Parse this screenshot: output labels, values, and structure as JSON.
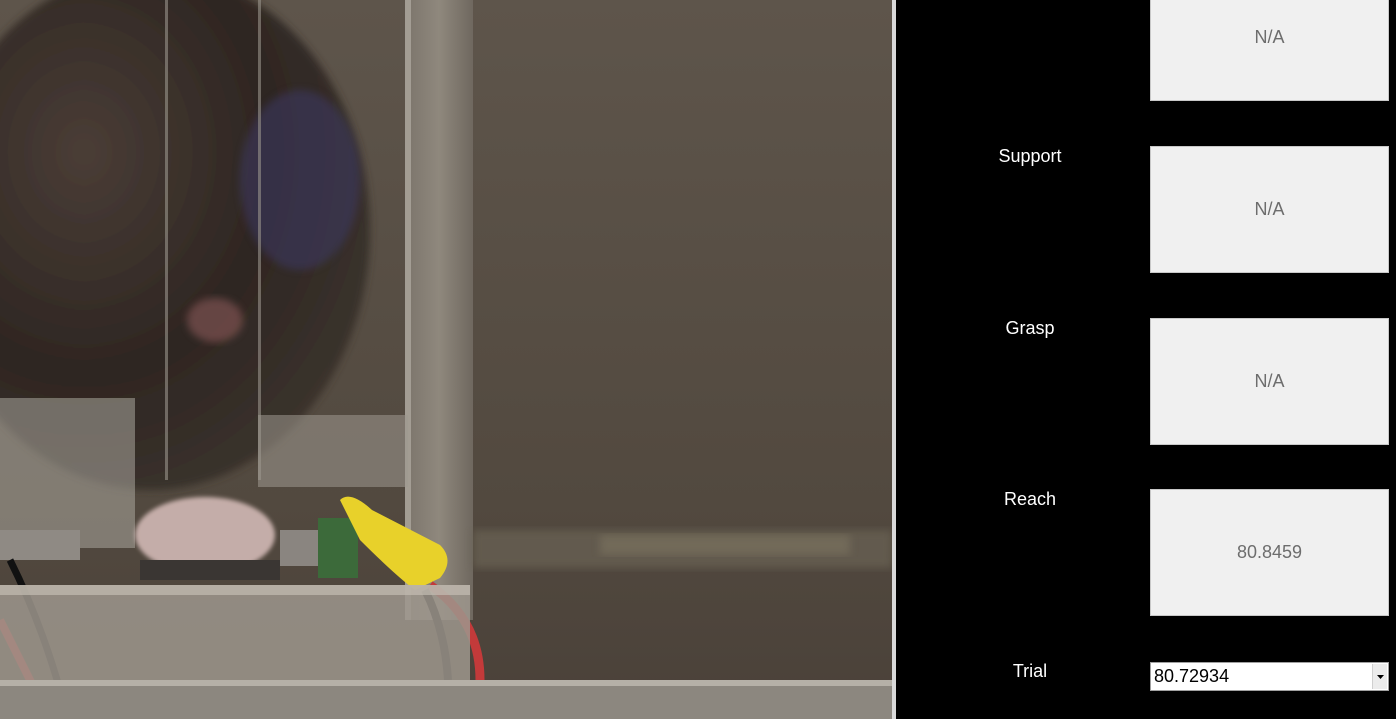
{
  "video": {
    "icon": "video-frame-image"
  },
  "rows": [
    {
      "label": "",
      "value": "N/A"
    },
    {
      "label": "Support",
      "value": "N/A"
    },
    {
      "label": "Grasp",
      "value": "N/A"
    },
    {
      "label": "Reach",
      "value": "80.8459"
    }
  ],
  "trial": {
    "label": "Trial",
    "selected": "80.72934",
    "arrow_icon": "dropdown-arrow-icon"
  },
  "colors": {
    "background": "#000000",
    "box_fill": "#f0f0f0",
    "box_text": "#6d6d6d",
    "label_text": "#ffffff"
  }
}
